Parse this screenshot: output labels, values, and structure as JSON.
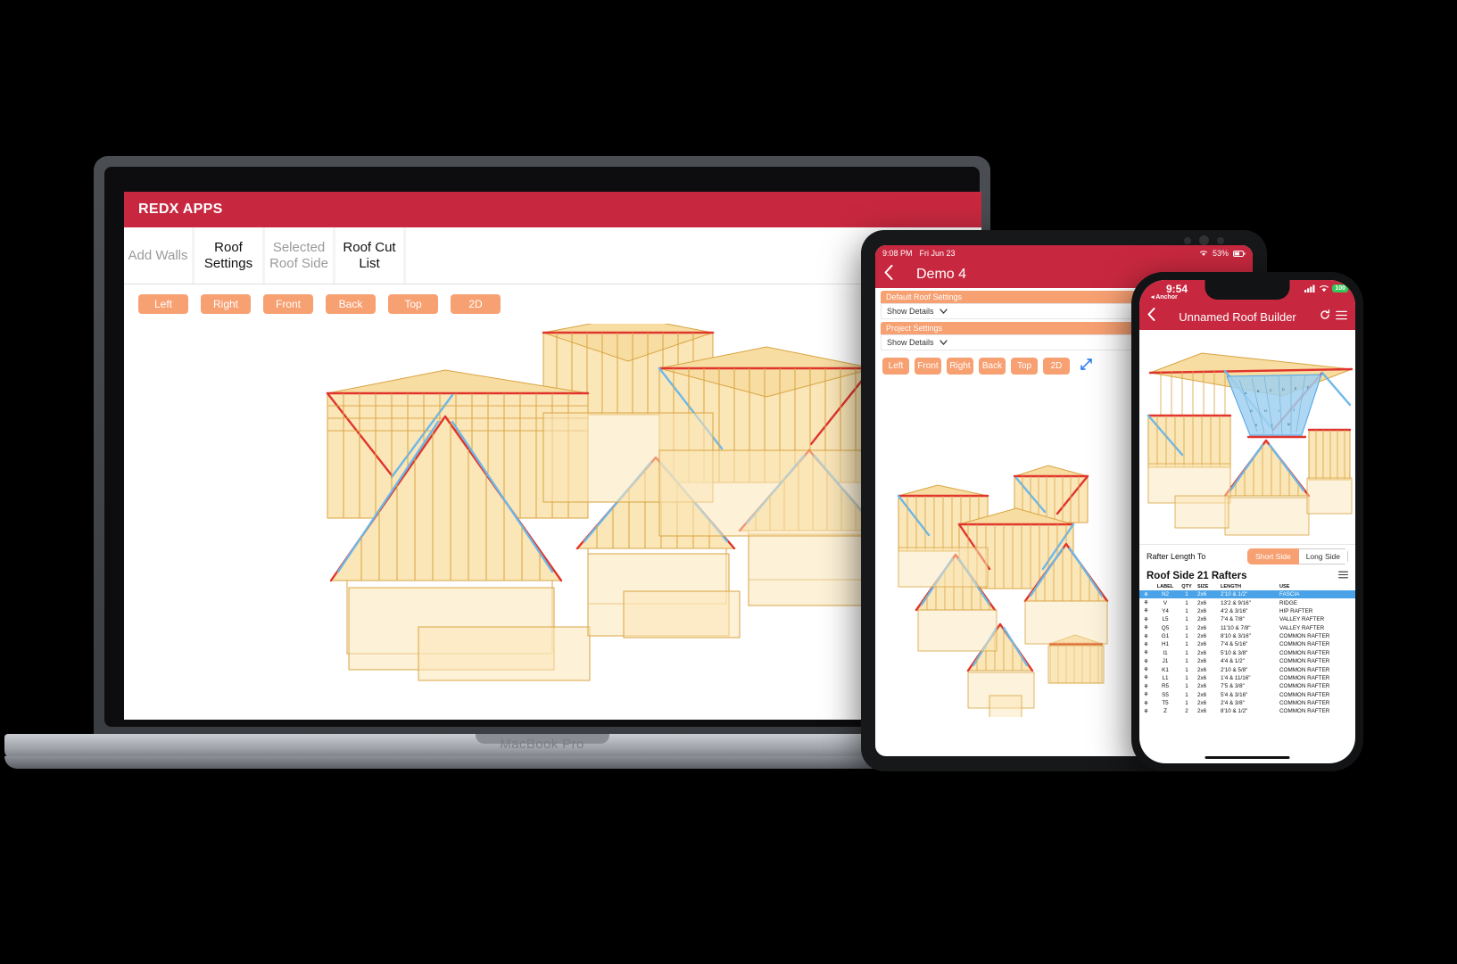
{
  "laptop": {
    "device_label": "MacBook Pro",
    "app": {
      "brand": "REDX APPS",
      "tabs": [
        {
          "line1": "Add Walls",
          "line2": "",
          "state": "disabled"
        },
        {
          "line1": "Roof",
          "line2": "Settings",
          "state": "active"
        },
        {
          "line1": "Selected",
          "line2": "Roof Side",
          "state": "disabled"
        },
        {
          "line1": "Roof Cut",
          "line2": "List",
          "state": "enabled"
        }
      ],
      "view_buttons": [
        "Left",
        "Right",
        "Front",
        "Back",
        "Top",
        "2D"
      ]
    }
  },
  "tablet": {
    "status": {
      "time": "9:08 PM",
      "date": "Fri Jun 23",
      "wifi_icon": "wifi-icon",
      "battery": "53%"
    },
    "nav": {
      "back_icon": "chevron-left-icon",
      "title": "Demo 4"
    },
    "sections": [
      {
        "title": "Default Roof Settings",
        "control_label": "Show Details",
        "chevron": "chevron-down-icon"
      },
      {
        "title": "Project Settings",
        "control_label": "Show Details",
        "chevron": "chevron-down-icon"
      }
    ],
    "view_buttons": [
      "Left",
      "Front",
      "Right",
      "Back",
      "Top",
      "2D"
    ],
    "expand_icon": "expand-arrows-icon"
  },
  "phone": {
    "status": {
      "time": "9:54",
      "back_app": "◂ Anchor",
      "cell_icon": "signal-icon",
      "wifi_icon": "wifi-icon",
      "battery": "100"
    },
    "nav": {
      "back_icon": "chevron-left-icon",
      "title": "Unnamed Roof Builder",
      "refresh_icon": "refresh-icon",
      "menu_icon": "hamburger-menu-icon"
    },
    "rafter_length": {
      "label": "Rafter Length To",
      "options": [
        "Short Side",
        "Long Side"
      ],
      "selected": "Short Side"
    },
    "list": {
      "title": "Roof Side 21 Rafters",
      "menu_icon": "hamburger-menu-icon",
      "columns": [
        "LABEL",
        "QTY",
        "SIZE",
        "LENGTH",
        "USE"
      ],
      "row_icon": "rafter-icon",
      "rows": [
        {
          "label": "N2",
          "qty": "1",
          "size": "2x6",
          "length": "2'10 & 1/2\"",
          "use": "FASCIA",
          "selected": true
        },
        {
          "label": "V",
          "qty": "1",
          "size": "2x6",
          "length": "13'2 & 9/16\"",
          "use": "RIDGE",
          "selected": false
        },
        {
          "label": "Y4",
          "qty": "1",
          "size": "2x6",
          "length": "4'2 & 3/16\"",
          "use": "HIP RAFTER",
          "selected": false
        },
        {
          "label": "L5",
          "qty": "1",
          "size": "2x6",
          "length": "7'4 & 7/8\"",
          "use": "VALLEY RAFTER",
          "selected": false
        },
        {
          "label": "Q5",
          "qty": "1",
          "size": "2x6",
          "length": "11'10 & 7/8\"",
          "use": "VALLEY RAFTER",
          "selected": false
        },
        {
          "label": "G1",
          "qty": "1",
          "size": "2x6",
          "length": "8'10 & 3/16\"",
          "use": "COMMON RAFTER",
          "selected": false
        },
        {
          "label": "H1",
          "qty": "1",
          "size": "2x6",
          "length": "7'4 & 5/16\"",
          "use": "COMMON RAFTER",
          "selected": false
        },
        {
          "label": "I1",
          "qty": "1",
          "size": "2x6",
          "length": "5'10 & 3/8\"",
          "use": "COMMON RAFTER",
          "selected": false
        },
        {
          "label": "J1",
          "qty": "1",
          "size": "2x6",
          "length": "4'4 & 1/2\"",
          "use": "COMMON RAFTER",
          "selected": false
        },
        {
          "label": "K1",
          "qty": "1",
          "size": "2x6",
          "length": "2'10 & 5/8\"",
          "use": "COMMON RAFTER",
          "selected": false
        },
        {
          "label": "L1",
          "qty": "1",
          "size": "2x6",
          "length": "1'4 & 11/16\"",
          "use": "COMMON RAFTER",
          "selected": false
        },
        {
          "label": "R5",
          "qty": "1",
          "size": "2x6",
          "length": "7'5 & 3/8\"",
          "use": "COMMON RAFTER",
          "selected": false
        },
        {
          "label": "S5",
          "qty": "1",
          "size": "2x6",
          "length": "5'4 & 3/16\"",
          "use": "COMMON RAFTER",
          "selected": false
        },
        {
          "label": "T5",
          "qty": "1",
          "size": "2x6",
          "length": "2'4 & 3/8\"",
          "use": "COMMON RAFTER",
          "selected": false
        },
        {
          "label": "Z",
          "qty": "2",
          "size": "2x6",
          "length": "8'10 & 1/2\"",
          "use": "COMMON RAFTER",
          "selected": false
        }
      ]
    }
  },
  "colors": {
    "brand_red": "#c8283f",
    "accent_orange": "#f7a072",
    "lumber": "#fbe6b8",
    "ridge_red": "#e0342c",
    "valley_blue": "#6cb8e8",
    "selection_blue": "#4aa3e8",
    "battery_green": "#35c759"
  }
}
